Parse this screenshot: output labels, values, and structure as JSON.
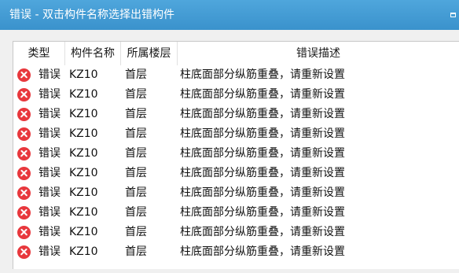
{
  "window": {
    "title": "错误 - 双击构件名称选择出错构件"
  },
  "table": {
    "columns": [
      "类型",
      "构件名称",
      "所属楼层",
      "错误描述"
    ],
    "rows": [
      {
        "type": "错误",
        "name": "KZ10",
        "floor": "首层",
        "desc": "柱底面部分纵筋重叠，请重新设置"
      },
      {
        "type": "错误",
        "name": "KZ10",
        "floor": "首层",
        "desc": "柱底面部分纵筋重叠，请重新设置"
      },
      {
        "type": "错误",
        "name": "KZ10",
        "floor": "首层",
        "desc": "柱底面部分纵筋重叠，请重新设置"
      },
      {
        "type": "错误",
        "name": "KZ10",
        "floor": "首层",
        "desc": "柱底面部分纵筋重叠，请重新设置"
      },
      {
        "type": "错误",
        "name": "KZ10",
        "floor": "首层",
        "desc": "柱底面部分纵筋重叠，请重新设置"
      },
      {
        "type": "错误",
        "name": "KZ10",
        "floor": "首层",
        "desc": "柱底面部分纵筋重叠，请重新设置"
      },
      {
        "type": "错误",
        "name": "KZ10",
        "floor": "首层",
        "desc": "柱底面部分纵筋重叠，请重新设置"
      },
      {
        "type": "错误",
        "name": "KZ10",
        "floor": "首层",
        "desc": "柱底面部分纵筋重叠，请重新设置"
      },
      {
        "type": "错误",
        "name": "KZ10",
        "floor": "首层",
        "desc": "柱底面部分纵筋重叠，请重新设置"
      },
      {
        "type": "错误",
        "name": "KZ10",
        "floor": "首层",
        "desc": "柱底面部分纵筋重叠，请重新设置"
      }
    ]
  },
  "icons": {
    "row_icon": "error-circle-icon"
  },
  "colors": {
    "titlebar": "#3a92cc",
    "error": "#e8383d"
  }
}
